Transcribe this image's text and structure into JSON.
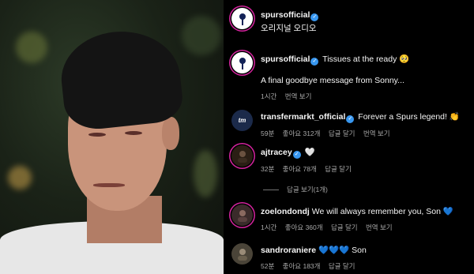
{
  "post": {
    "author": "spursofficial",
    "audio_label": "오리지널 오디오"
  },
  "comments": [
    {
      "username": "spursofficial",
      "text": "Tissues at the ready",
      "emoji": "🥺",
      "line2": "A final goodbye message from Sonny...",
      "time": "1시간",
      "see_translation": "번역 보기"
    },
    {
      "username": "transfermarkt_official",
      "avatar_text": "tm",
      "text": "Forever a Spurs legend!",
      "emoji": "👏",
      "time": "59분",
      "likes": "좋아요 312개",
      "reply": "답글 달기",
      "see_translation": "번역 보기"
    },
    {
      "username": "ajtracey",
      "emoji": "🤍",
      "time": "32분",
      "likes": "좋아요 78개",
      "reply": "답글 달기",
      "view_replies": "답글 보기(1개)"
    },
    {
      "username": "zoelondondj",
      "text": "We will always remember you, Son",
      "emoji": "💙",
      "time": "1시간",
      "likes": "좋아요 360개",
      "reply": "답글 달기",
      "see_translation": "번역 보기"
    },
    {
      "username": "sandroraniere",
      "emoji": "💙💙💙",
      "text": "Son",
      "time": "52분",
      "likes": "좋아요 183개",
      "reply": "답글 달기"
    }
  ],
  "colors": {
    "background": "#000000",
    "verified": "#3897f0",
    "meta_text": "#a8a8a8",
    "story_ring": "#d6249f"
  },
  "icons": [
    "verified-badge-icon"
  ]
}
